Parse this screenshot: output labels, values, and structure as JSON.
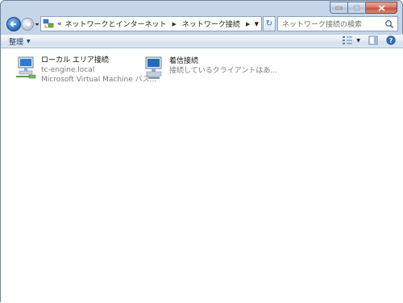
{
  "address_bar": {
    "crumbs": [
      {
        "label": "«"
      },
      {
        "label": "ネットワークとインターネット"
      },
      {
        "label": "ネットワーク接続"
      }
    ]
  },
  "search": {
    "placeholder": "ネットワーク接続の検索"
  },
  "toolbar": {
    "organize_label": "整理"
  },
  "connections": [
    {
      "title": "ローカル エリア接続",
      "line1": "tc-engine.local",
      "line2": "Microsoft Virtual Machine バス..."
    },
    {
      "title": "着信接続",
      "line1": "接続しているクライアントはあ...",
      "line2": ""
    }
  ],
  "colors": {
    "accent": "#2369bd",
    "window_frame": "#c3d4e7",
    "toolbar_text": "#1e395b"
  }
}
